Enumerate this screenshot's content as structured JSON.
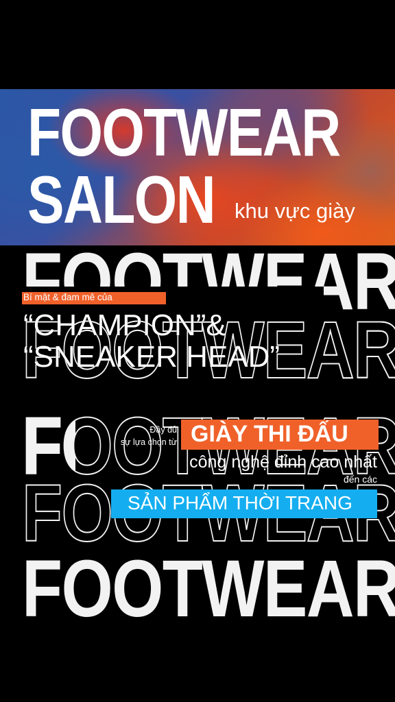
{
  "hero": {
    "line1": "FOOTWEAR",
    "line2": "SALON",
    "subtitle": "khu vực giày"
  },
  "ghost_word": "FOOTWEAR",
  "tagline": {
    "label": "Bí mật & đam mê của",
    "quote1": "“CHAMPION”&",
    "quote2": "“SNEAKER HEAD”"
  },
  "feature": {
    "intro1": "Đầy đủ",
    "intro2": "sự lựa chọn từ",
    "highlight1": "GIÀY THI ĐẤU",
    "line_tech": "công nghệ đỉnh cao nhất",
    "line_to": "đến các",
    "highlight2": "SẢN PHẨM THỜI TRANG"
  },
  "colors": {
    "orange": "#f0612a",
    "blue": "#14aef0",
    "black": "#000000",
    "white": "#ffffff"
  }
}
